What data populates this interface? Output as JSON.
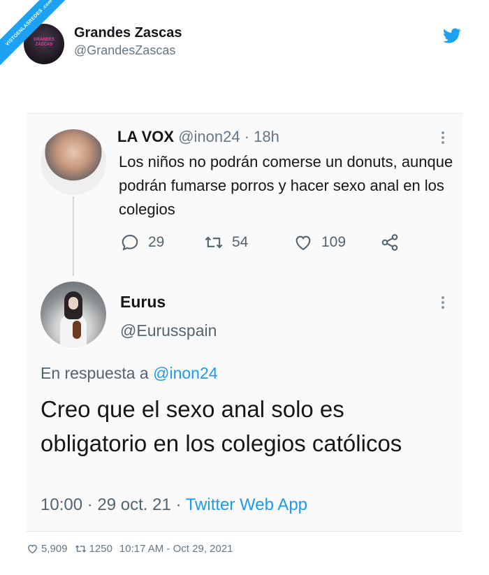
{
  "watermark": {
    "text": "VISTOENLASREDES .com"
  },
  "outer_tweet": {
    "name": "Grandes Zascas",
    "handle": "@GrandesZascas",
    "avatar_text": "GRANDES ZASCAS",
    "likes": "5,909",
    "retweets": "1250",
    "timestamp": "10:17 AM - Oct 29, 2021"
  },
  "quoted": {
    "tweet1": {
      "name": "LA VOX",
      "handle_time": " @inon24 · 18h",
      "text": "Los niños no podrán comerse un donuts, aunque podrán fumarse porros y hacer sexo anal en los colegios",
      "replies": "29",
      "retweets": "54",
      "likes": "109"
    },
    "tweet2": {
      "name": "Eurus",
      "handle": "@Eurusspain",
      "reply_prefix": "En respuesta a ",
      "reply_handle": "@inon24",
      "text": "Creo que el sexo anal solo es obligatorio en los colegios católicos",
      "time_date": "10:00 · 29 oct. 21 · ",
      "app": "Twitter Web App"
    }
  },
  "colors": {
    "twitter_blue": "#1da1f2",
    "link_blue": "#1d9bf0",
    "muted": "#536471"
  },
  "icons": [
    "twitter-bird-icon",
    "reply-icon",
    "retweet-icon",
    "heart-icon",
    "share-icon",
    "more-dots-icon"
  ]
}
